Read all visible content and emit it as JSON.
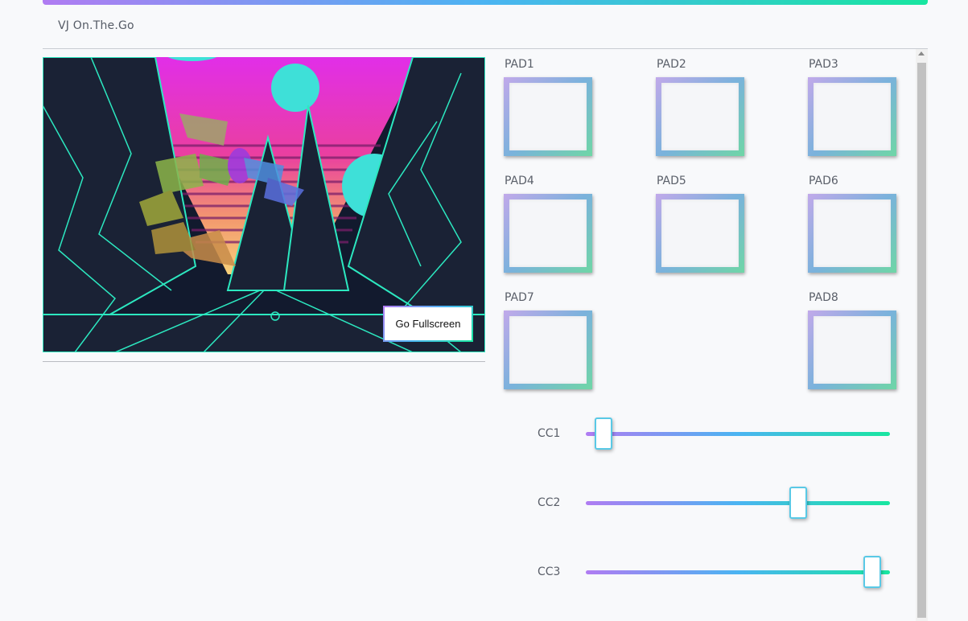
{
  "app": {
    "title": "VJ On.The.Go"
  },
  "video": {
    "fullscreen_label": "Go Fullscreen"
  },
  "pads": [
    {
      "label": "PAD1"
    },
    {
      "label": "PAD2"
    },
    {
      "label": "PAD3"
    },
    {
      "label": "PAD4"
    },
    {
      "label": "PAD5"
    },
    {
      "label": "PAD6"
    },
    {
      "label": "PAD7"
    },
    {
      "label": "PAD8"
    }
  ],
  "sliders": [
    {
      "label": "CC1",
      "value": 0.03
    },
    {
      "label": "CC2",
      "value": 0.71
    },
    {
      "label": "CC3",
      "value": 0.97
    }
  ],
  "colors": {
    "accent_start": "#b07cf2",
    "accent_mid": "#4bb4f2",
    "accent_end": "#18e6a0"
  }
}
